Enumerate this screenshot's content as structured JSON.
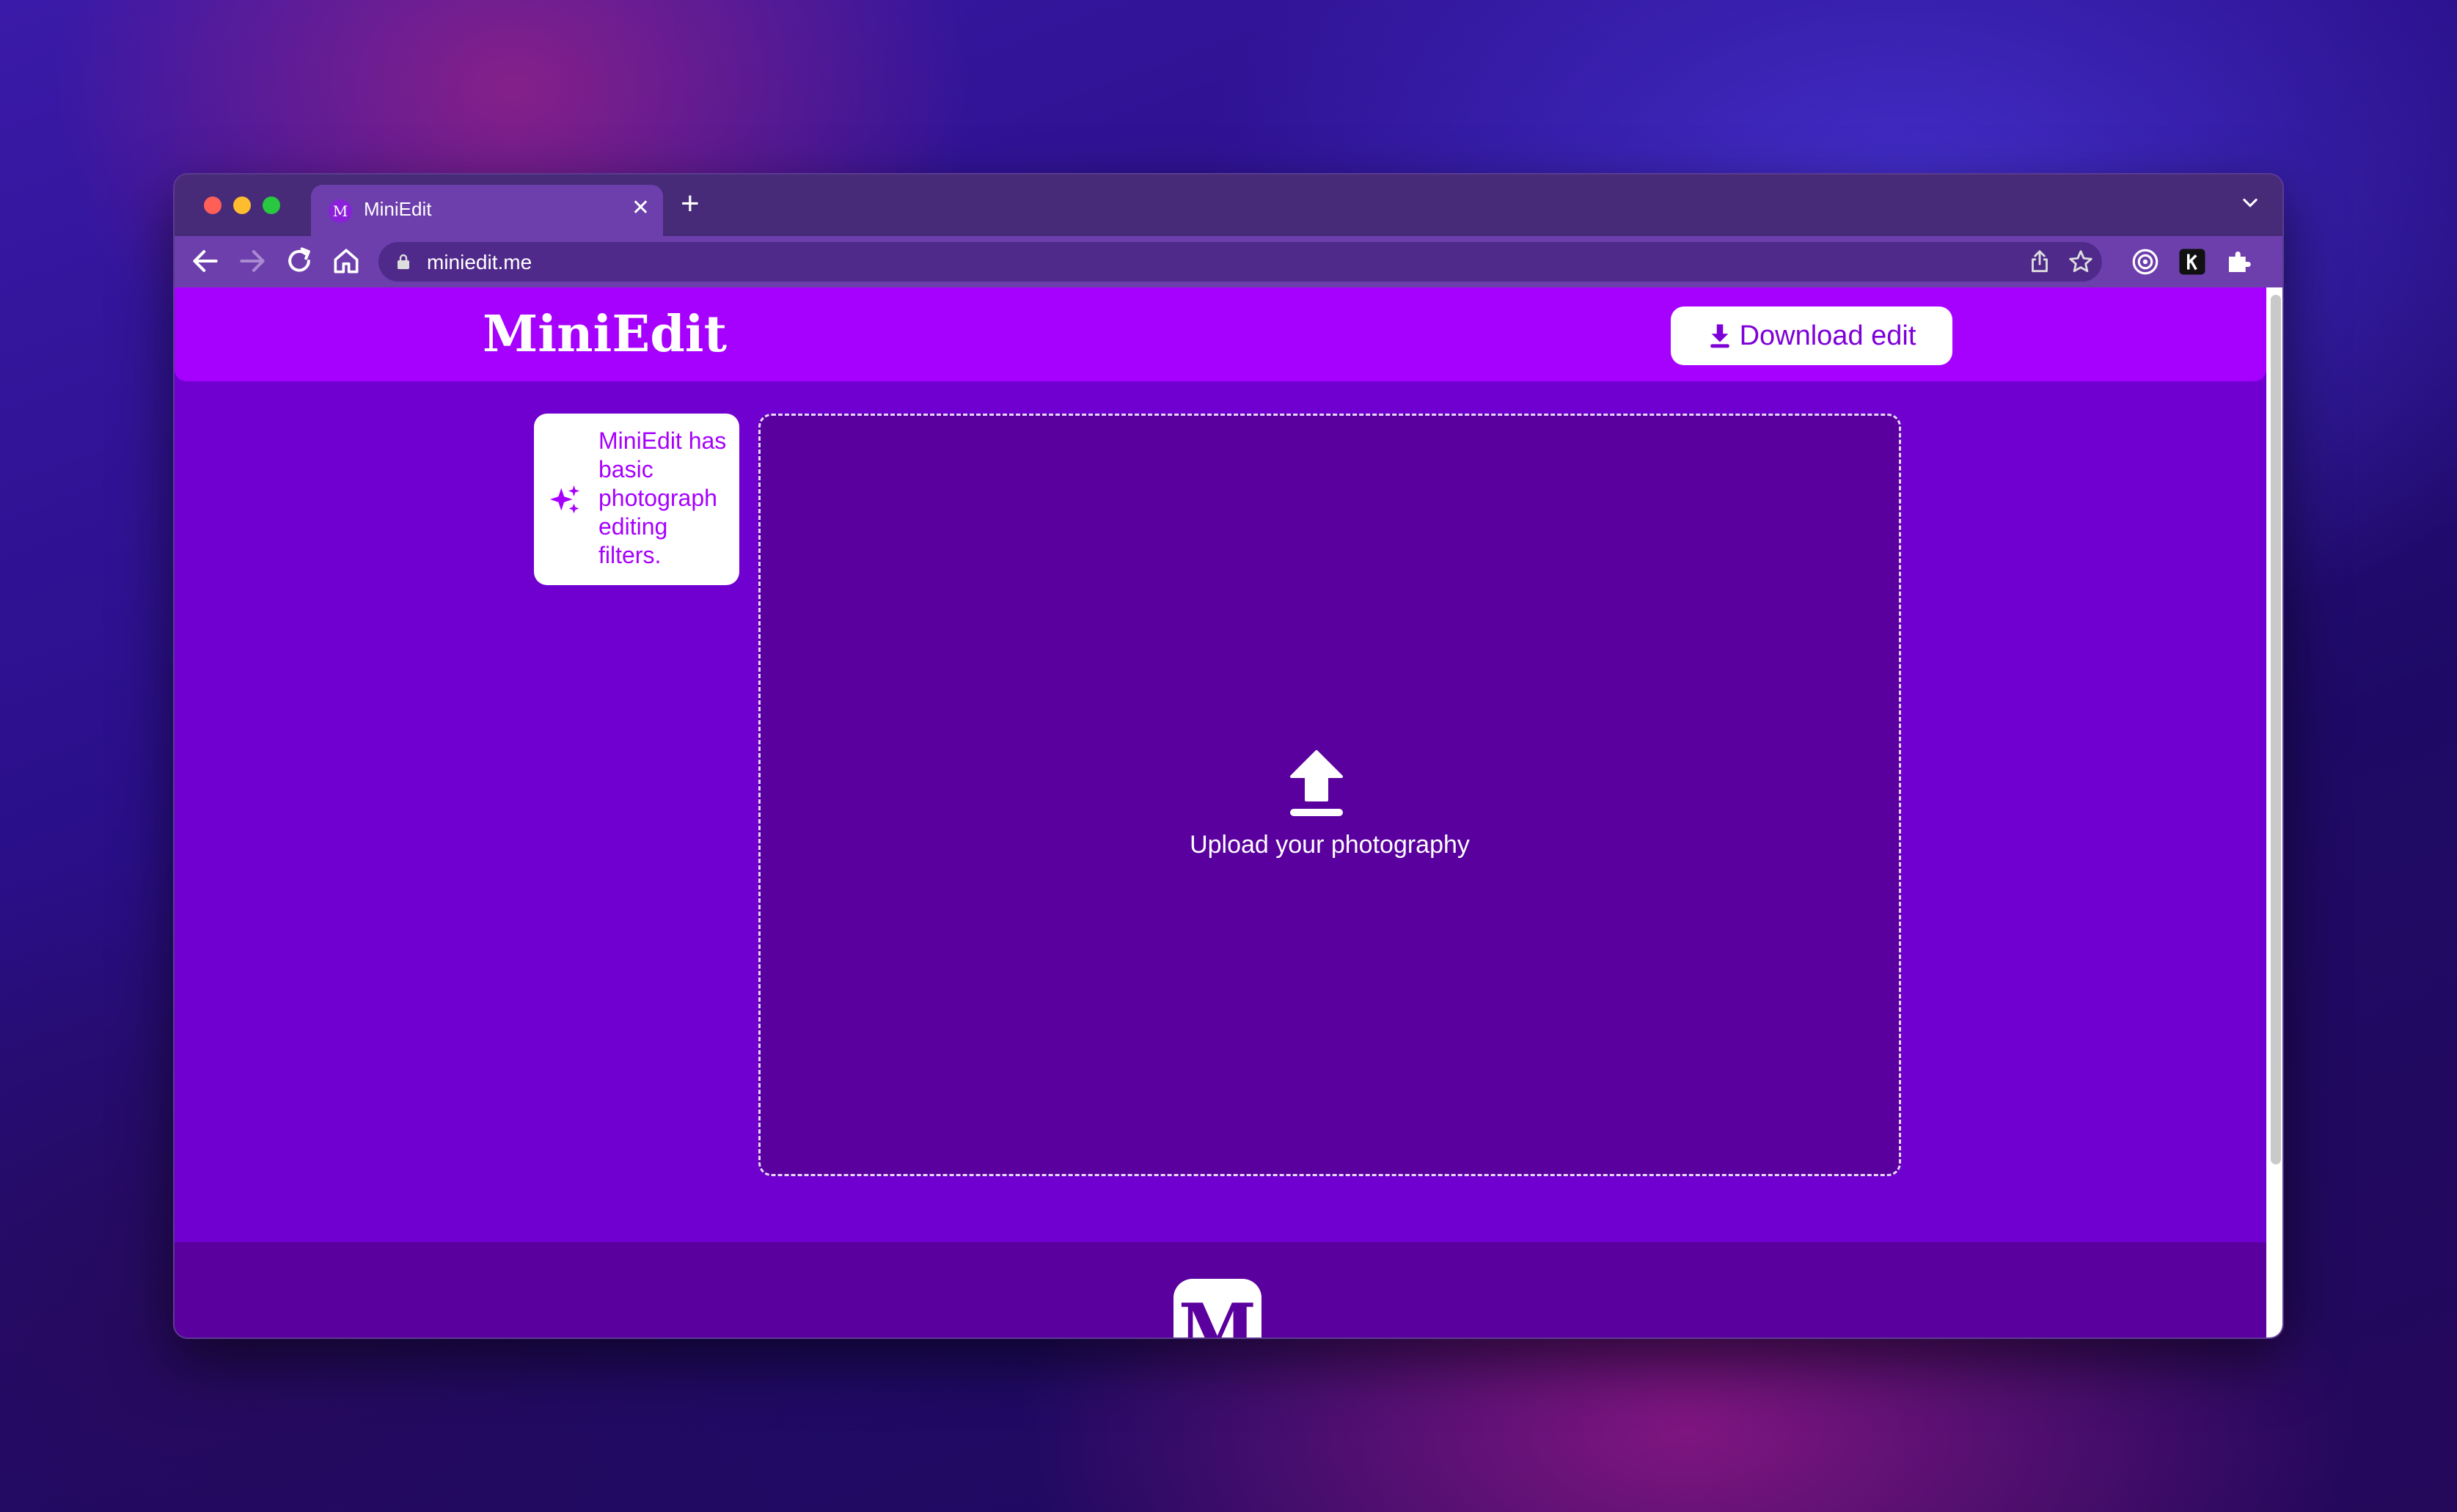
{
  "browser": {
    "tab": {
      "title": "MiniEdit",
      "favicon_letter": "M"
    },
    "url": "miniedit.me"
  },
  "app": {
    "logo": "MiniEdit",
    "download_label": "Download edit",
    "info_text": "MiniEdit has basic photograph editing filters.",
    "upload_label": "Upload your photography",
    "footer_logo_letter": "M"
  },
  "colors": {
    "header": "#a600ff",
    "background": "#6f00cf",
    "dropzone": "#5a009e",
    "browser_chrome": "#6d3fac"
  },
  "icons": [
    "back-arrow-icon",
    "forward-arrow-icon",
    "reload-icon",
    "home-icon",
    "lock-icon",
    "share-icon",
    "star-icon",
    "download-icon",
    "sparkle-icon",
    "upload-icon"
  ]
}
